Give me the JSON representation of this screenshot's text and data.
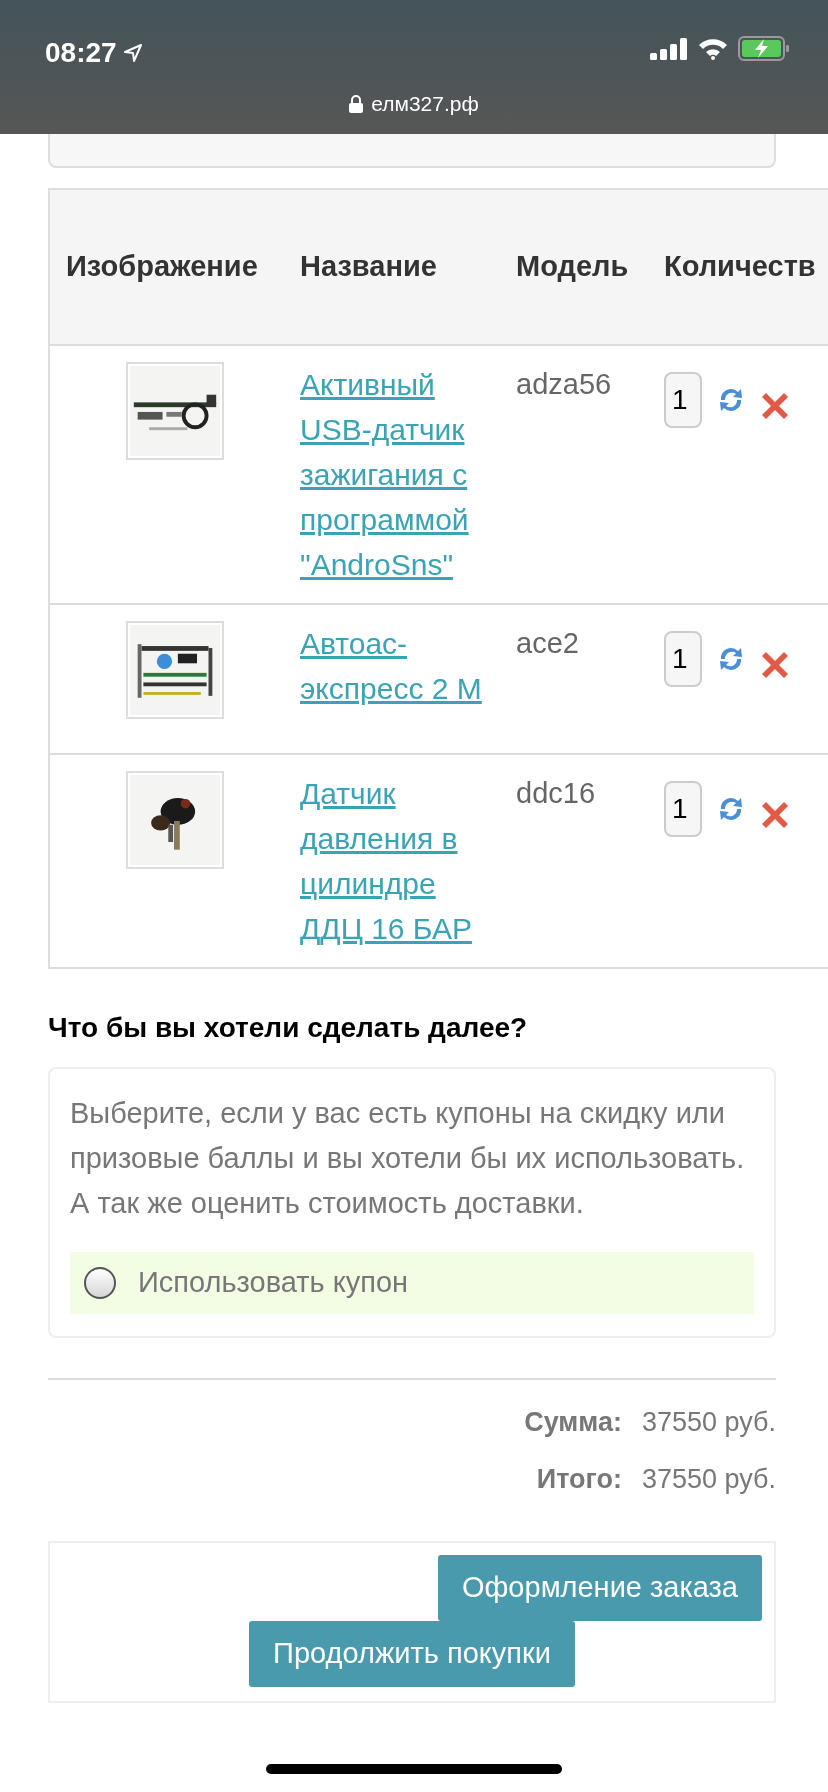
{
  "status_bar": {
    "time": "08:27",
    "url": "елм327.рф"
  },
  "table": {
    "columns": [
      "Изображение",
      "Название",
      "Модель",
      "Количеств"
    ],
    "rows": [
      {
        "name": "Активный USB-датчик зажигания с программой \"AndroSns\"",
        "model": "adza56",
        "quantity": "1"
      },
      {
        "name": "Автоас-экспресс 2 М",
        "model": "ace2",
        "quantity": "1"
      },
      {
        "name": "Датчик давления в цилиндре ДДЦ 16 БАР",
        "model": "ddc16",
        "quantity": "1"
      }
    ]
  },
  "next_steps": {
    "heading": "Что бы вы хотели сделать далее?",
    "description": "Выберите, если у вас есть купоны на скидку или призовые баллы и вы хотели бы их использовать. А так же оценить стоимость доставки.",
    "options": [
      {
        "label": "Использовать купон",
        "selected": false
      }
    ]
  },
  "totals": [
    {
      "label": "Сумма:",
      "value": "37550 руб."
    },
    {
      "label": "Итого:",
      "value": "37550 руб."
    }
  ],
  "buttons": [
    "Оформление заказа",
    "Продолжить покупки"
  ]
}
